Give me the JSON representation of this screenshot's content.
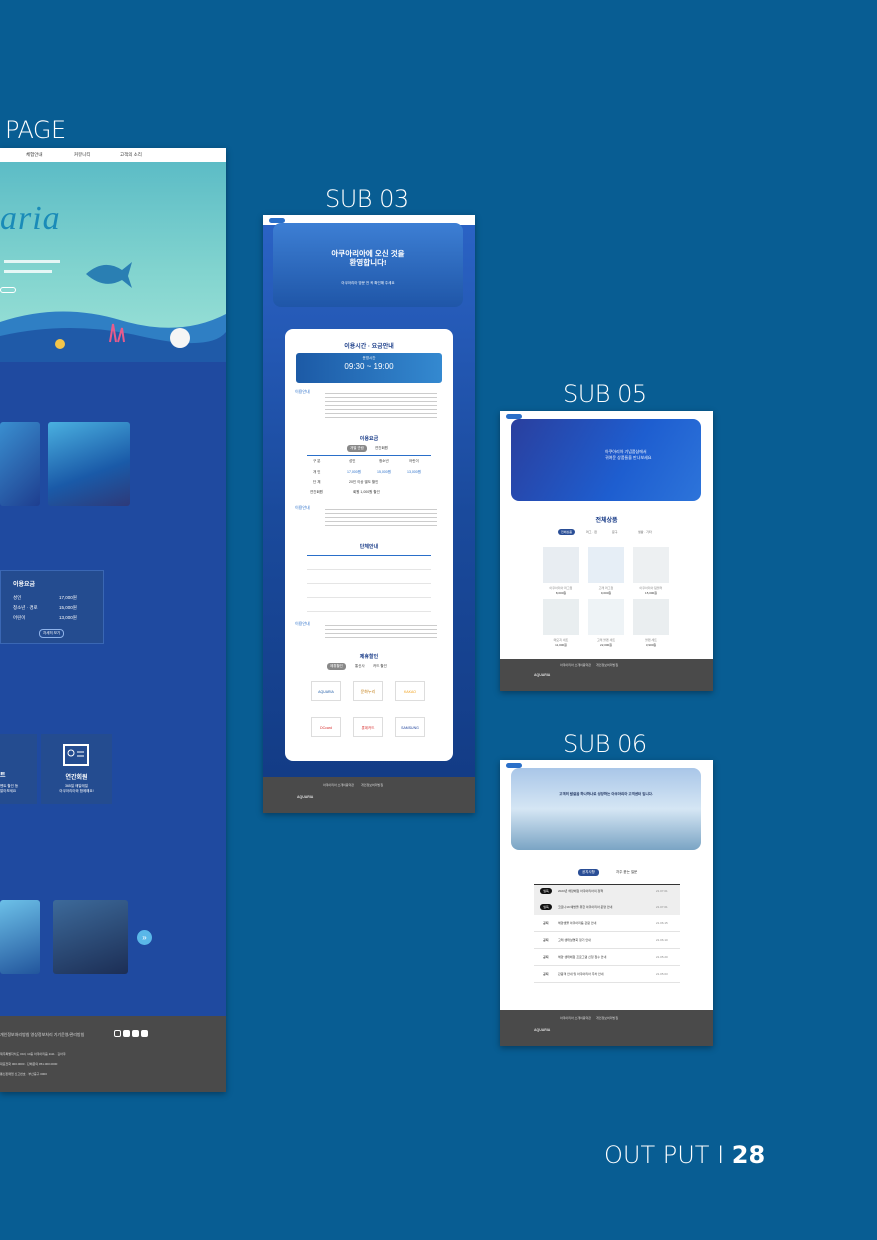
{
  "labels": {
    "main_page": "PAGE",
    "sub03": "SUB 03",
    "sub05": "SUB 05",
    "sub06": "SUB 06",
    "output_prefix": "OUT PUT I ",
    "output_num": "28"
  },
  "main": {
    "nav": [
      "체험안내",
      "커뮤니티",
      "고객의 소리"
    ],
    "hero_word": "aria",
    "fee_title": "이용요금",
    "fee_rows": [
      {
        "k": "성인",
        "v": "17,000원"
      },
      {
        "k": "청소년 · 경로",
        "v": "15,000원"
      },
      {
        "k": "어린이",
        "v": "13,000원"
      }
    ],
    "fee_btn": "자세히 보기",
    "tile_a_title": "트",
    "tile_a_text": "벤트 할인 등\n알아보세요",
    "tile_b_title": "연간회원",
    "tile_b_text": "365일 매일매일\n아쿠아리아와 함께해요!",
    "footer_links": "개인정보처리방침   영상정보처리 기기운영/관리방침",
    "footer_lines": [
      "제주특별자치도 00시 10층 아쿠아리움 1111 · 김아쿠",
      "대표전화 000.0000 · 단체문의 051.000.0000",
      "통신판매업 신고번호 · 부산중구 0000"
    ]
  },
  "sub03": {
    "hero_title": "아쿠아리아에 오신 것을\n환영합니다!",
    "hero_sub": "아쿠아리아 방문 전 꼭 확인해 주세요",
    "section_hours": "이용시간 · 요금안내",
    "hours_label": "운영시간",
    "hours": "09:30 ~ 19:00",
    "notice": "이용안내",
    "section_fee": "이용요금",
    "fee_tabs": [
      "개별 관람",
      "연간회원"
    ],
    "fee_head": [
      "구 분",
      "성인",
      "청소년",
      "어린이"
    ],
    "fee_rows": [
      [
        "개 인",
        "17,000원",
        "15,000원",
        "13,000원"
      ],
      [
        "단 체",
        "20인 이상 별도 할인",
        "",
        ""
      ],
      [
        "연간회원",
        "회원 1,000원 할인",
        "",
        ""
      ]
    ],
    "section_group": "단체안내",
    "section_partner": "제휴할인",
    "partner_tabs": [
      "제휴할인",
      "통신사",
      "카드 할인"
    ],
    "partners": [
      "AQUARIA",
      "문화누리",
      "KAKAO",
      "DCcard",
      "롯데카드",
      "SAMSUNG"
    ]
  },
  "sub05": {
    "hero_text": "아쿠아리아 기념품샵에서\n귀여운 상품들을 만나보세요",
    "title": "전체상품",
    "tabs": [
      "전체상품",
      "머그 · 컵",
      "문구",
      "생활 · 기타"
    ],
    "products": [
      {
        "name": "아쿠아리아 머그컵",
        "price": "8,000원"
      },
      {
        "name": "고래 머그컵",
        "price": "9,000원"
      },
      {
        "name": "아쿠아리아 텀블러",
        "price": "15,000원"
      },
      {
        "name": "메모지 세트",
        "price": "11,000원"
      },
      {
        "name": "고래 볼펜 세트",
        "price": "22,000원"
      },
      {
        "name": "볼펜 세트",
        "price": "3,900원"
      }
    ]
  },
  "sub06": {
    "hero_text": "고객의 발걸음 하나하나로 성장하는 아쿠아리아 고객센터 입니다.",
    "tabs": [
      "공지사항",
      "자주 묻는 질문"
    ],
    "rows": [
      {
        "tag": "필독",
        "title": "2023년 해양체험 아쿠아리아의 정책",
        "date": "21.07.01"
      },
      {
        "tag": "필독",
        "title": "코로나19 예방을 위한 아쿠아리아 운영 안내",
        "date": "21.07.01"
      },
      {
        "tag": "공지",
        "title": "해양생물 아쿠아리움 관람 안내",
        "date": "21.06.15"
      },
      {
        "tag": "공지",
        "title": "고래 생태설명회 정기 안내",
        "date": "21.06.10"
      },
      {
        "tag": "공지",
        "title": "해양 생태체험 프로그램 신청 접수 안내",
        "date": "21.05.20"
      },
      {
        "tag": "공지",
        "title": "관람객 안내 및 아쿠아리아 주차 안내",
        "date": "21.05.03"
      }
    ]
  },
  "footer": {
    "logo": "AQUARIA",
    "links": [
      "아쿠아리아 소개",
      "이용약관",
      "개인정보처리방침",
      "영상정보처리 기기운영/관리방침"
    ]
  },
  "colors": {
    "background": "#085d93",
    "accent": "#2a6fc9",
    "footer": "#4a4a4a"
  }
}
